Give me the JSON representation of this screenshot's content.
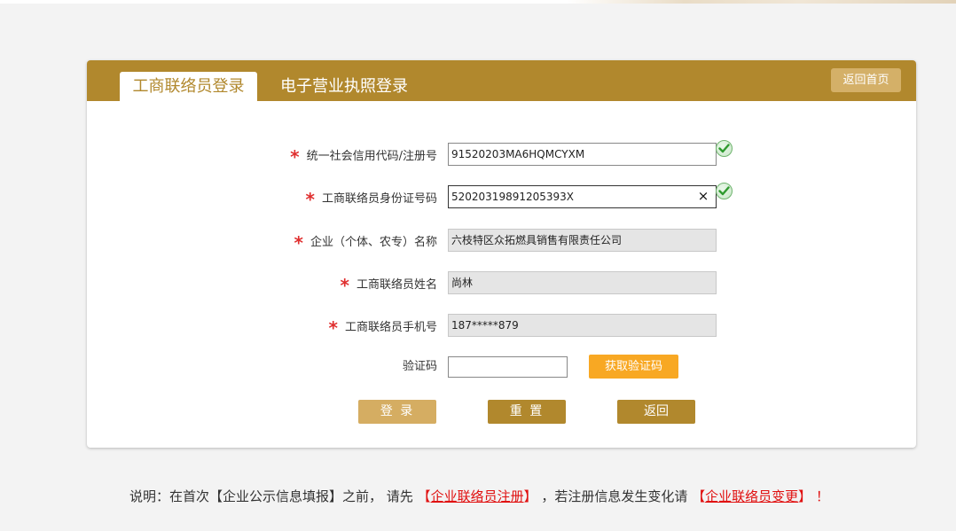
{
  "tabs": [
    {
      "label": "工商联络员登录",
      "active": true
    },
    {
      "label": "电子营业执照登录",
      "active": false
    }
  ],
  "header": {
    "home_button": "返回首页"
  },
  "form": {
    "required_mark": "*",
    "credit_code": {
      "label": "统一社会信用代码/注册号",
      "value": "91520203MA6HQMCYXM"
    },
    "id_number": {
      "label": "工商联络员身份证号码",
      "value": "52020319891205393X"
    },
    "company_name": {
      "label": "企业（个体、农专）名称",
      "value": "六枝特区众拓燃具销售有限责任公司"
    },
    "contact_name": {
      "label": "工商联络员姓名",
      "value": "尚林"
    },
    "phone": {
      "label": "工商联络员手机号",
      "value": "187*****879"
    },
    "captcha": {
      "label": "验证码",
      "value": "",
      "get_code_button": "获取验证码"
    },
    "clear_glyph": "×"
  },
  "buttons": {
    "login": "登 录",
    "reset": "重 置",
    "back": "返回"
  },
  "note": {
    "prefix": "说明：在首次【企业公示信息填报】之前， 请先 ",
    "register_open": "【",
    "register_link": "企业联络员注册",
    "register_close": "】",
    "middle": " ，若注册信息发生变化请 ",
    "change_open": "【",
    "change_link": "企业联络员变更",
    "change_close": "】",
    "suffix": " ！"
  },
  "colors": {
    "brand": "#b1882d",
    "accent": "#f8a823",
    "required": "#e03030",
    "link": "#e01010"
  }
}
